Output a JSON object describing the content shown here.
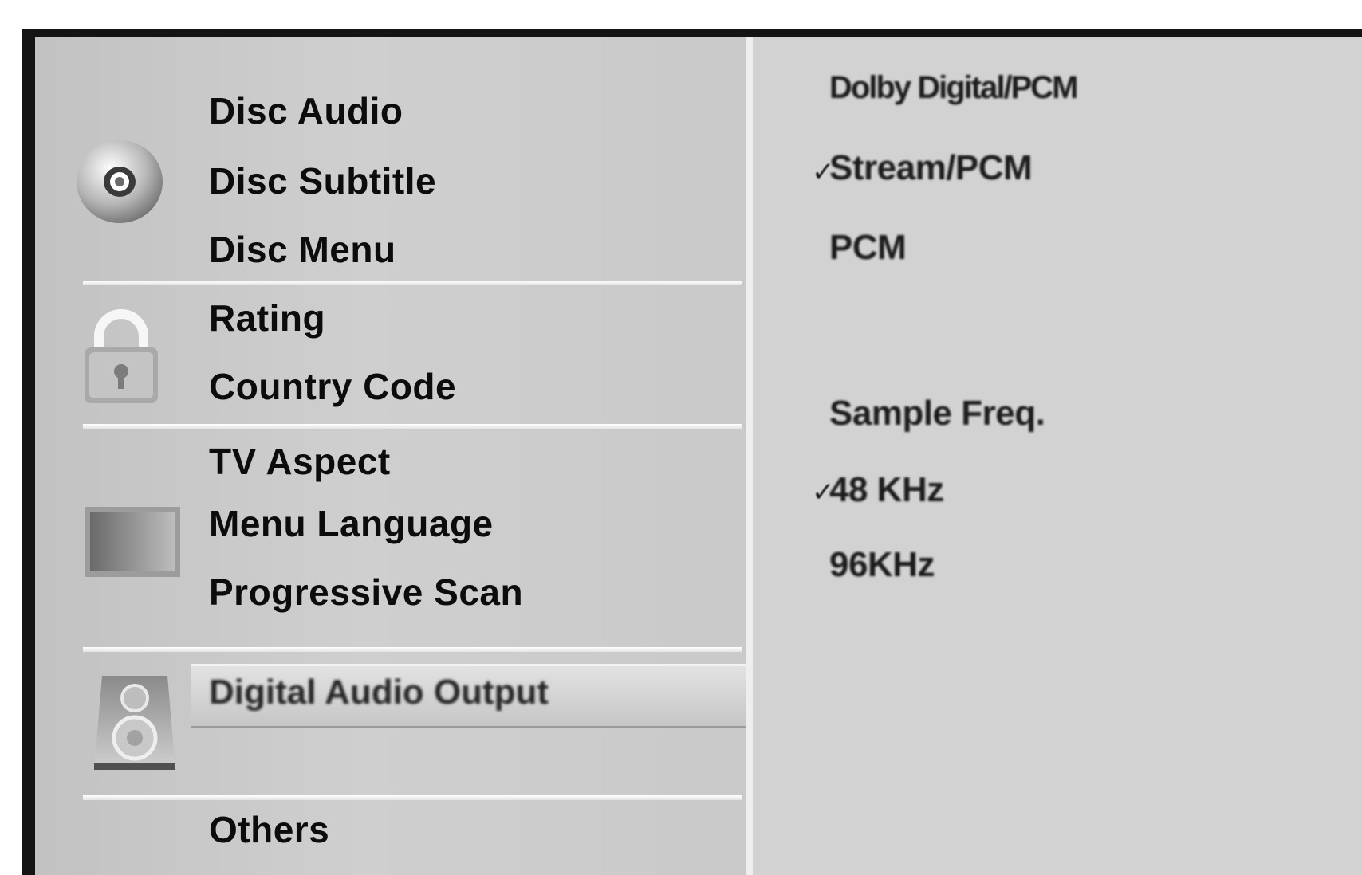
{
  "menu": {
    "items": [
      {
        "label": "Disc Audio"
      },
      {
        "label": "Disc Subtitle"
      },
      {
        "label": "Disc Menu"
      },
      {
        "label": "Rating"
      },
      {
        "label": "Country Code"
      },
      {
        "label": "TV Aspect"
      },
      {
        "label": "Menu Language"
      },
      {
        "label": "Progressive Scan"
      },
      {
        "label": "Digital Audio Output"
      },
      {
        "label": "Others"
      }
    ],
    "selected": "Digital Audio Output",
    "icons": [
      "disc-icon",
      "lock-icon",
      "tv-icon",
      "speaker-icon"
    ]
  },
  "options": {
    "audio_modes": [
      {
        "label": "Dolby Digital/PCM",
        "checked": false
      },
      {
        "label": "Stream/PCM",
        "checked": true
      },
      {
        "label": "PCM",
        "checked": false
      }
    ],
    "sample_freq_label": "Sample Freq.",
    "sample_freqs": [
      {
        "label": "48 KHz",
        "checked": true
      },
      {
        "label": "96KHz",
        "checked": false
      }
    ],
    "check_mark": "✓"
  },
  "colors": {
    "background": "#141414",
    "panel_left": "#c9c9c9",
    "panel_right": "#d2d2d2",
    "highlight": "#d8d8d8"
  }
}
